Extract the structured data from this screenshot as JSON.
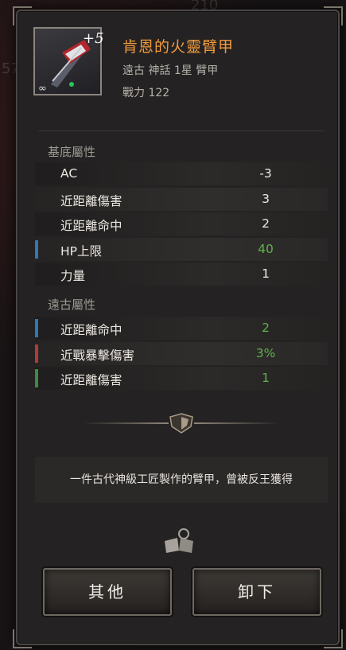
{
  "item": {
    "name": "肯恩的火靈臂甲",
    "enhance": "+5",
    "type_line": "遠古 神話 1星 臂甲",
    "power": "戰力 122"
  },
  "base_section": {
    "title": "基底屬性",
    "stats": [
      {
        "label": "AC",
        "value": "-3",
        "marker": null,
        "green": false
      },
      {
        "label": "近距離傷害",
        "value": "3",
        "marker": null,
        "green": false
      },
      {
        "label": "近距離命中",
        "value": "2",
        "marker": null,
        "green": false
      },
      {
        "label": "HP上限",
        "value": "40",
        "marker": "#2f78b8",
        "green": true
      },
      {
        "label": "力量",
        "value": "1",
        "marker": null,
        "green": false
      }
    ]
  },
  "ancient_section": {
    "title": "遠古屬性",
    "stats": [
      {
        "label": "近距離命中",
        "value": "2",
        "marker": "#2f78b8",
        "green": true
      },
      {
        "label": "近戰暴擊傷害",
        "value": "3%",
        "marker": "#b03a35",
        "green": true
      },
      {
        "label": "近距離傷害",
        "value": "1",
        "marker": "#3f8a45",
        "green": true
      }
    ]
  },
  "description": "一件古代神級工匠製作的臂甲，曾被反王獲得",
  "buttons": {
    "other": "其他",
    "unequip": "卸下"
  },
  "icons": {
    "codex": "codex-book-icon",
    "ornament": "shield-emblem-icon",
    "link": "link-chain-icon"
  },
  "colors": {
    "item_name": "#f29b3e",
    "value_green": "#5fb24a",
    "marker_blue": "#2f78b8",
    "marker_red": "#b03a35",
    "marker_green": "#3f8a45"
  }
}
